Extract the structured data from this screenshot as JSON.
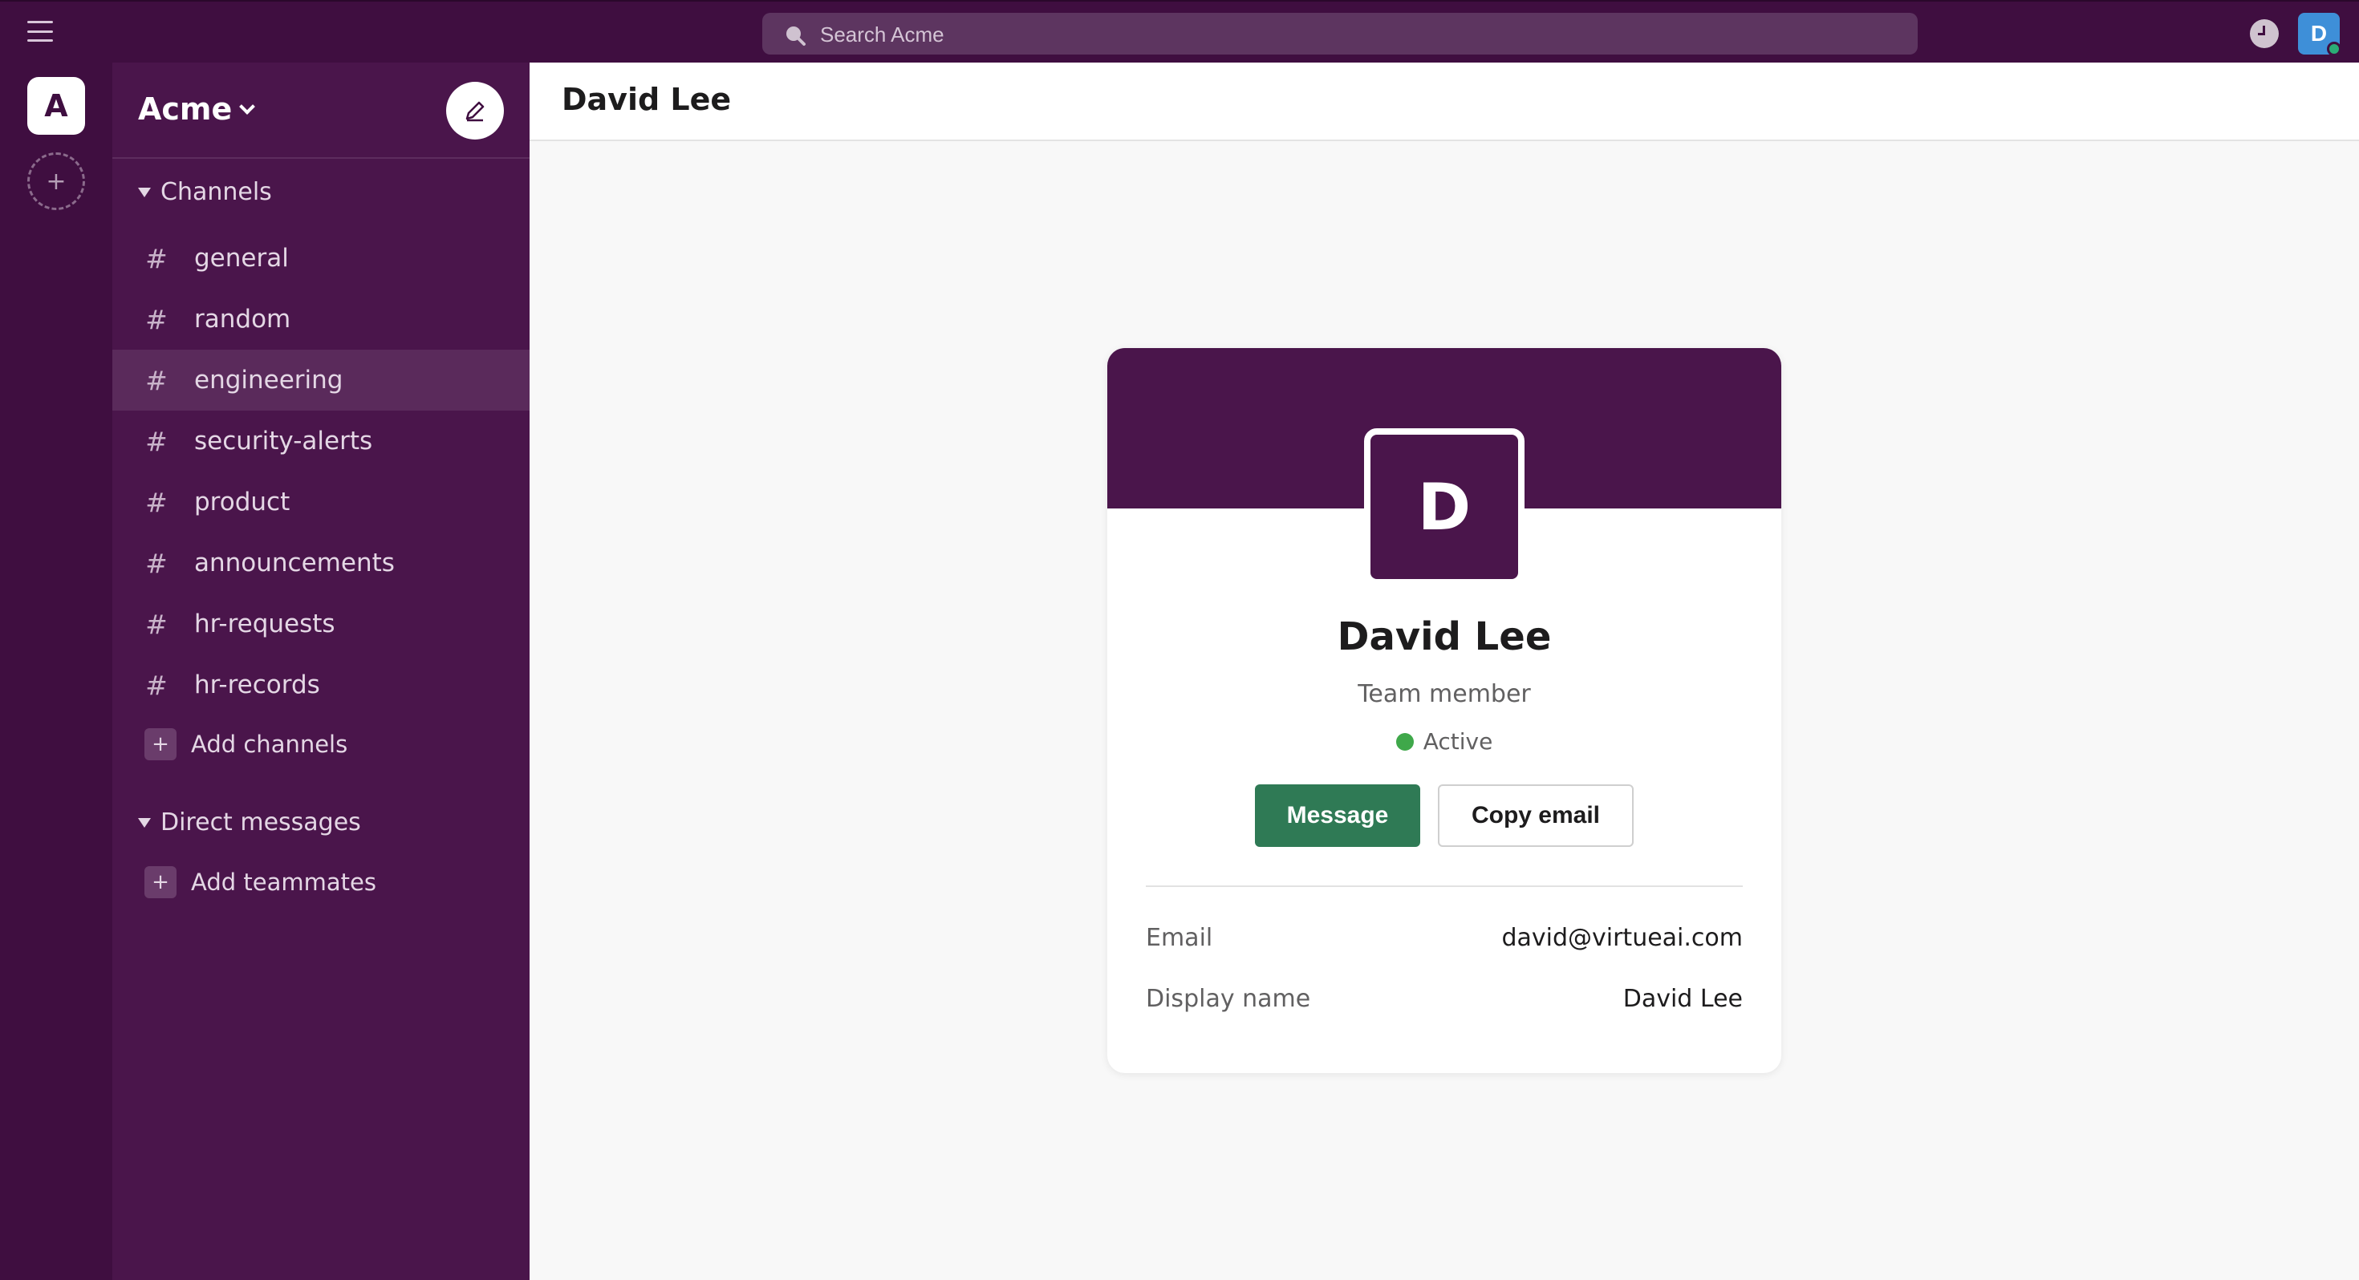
{
  "topbar": {
    "search_placeholder": "Search Acme",
    "user_initial": "D"
  },
  "workspace": {
    "initial": "A",
    "name": "Acme"
  },
  "sidebar": {
    "channels_header": "Channels",
    "channels": [
      {
        "label": "general",
        "active": false
      },
      {
        "label": "random",
        "active": false
      },
      {
        "label": "engineering",
        "active": true
      },
      {
        "label": "security-alerts",
        "active": false
      },
      {
        "label": "product",
        "active": false
      },
      {
        "label": "announcements",
        "active": false
      },
      {
        "label": "hr-requests",
        "active": false
      },
      {
        "label": "hr-records",
        "active": false
      }
    ],
    "add_channels": "Add channels",
    "dm_header": "Direct messages",
    "add_teammates": "Add teammates"
  },
  "main": {
    "title": "David Lee"
  },
  "profile": {
    "initial": "D",
    "name": "David Lee",
    "role": "Team member",
    "status": "Active",
    "message_button": "Message",
    "copy_email_button": "Copy email",
    "fields": [
      {
        "label": "Email",
        "value": "david@virtueai.com"
      },
      {
        "label": "Display name",
        "value": "David Lee"
      }
    ]
  },
  "colors": {
    "aubergine": "#4a154b",
    "topbar": "#3f0e40",
    "message_button": "#2f7a55",
    "status_active": "#3fa84a",
    "avatar_blue": "#3e8fd8"
  }
}
